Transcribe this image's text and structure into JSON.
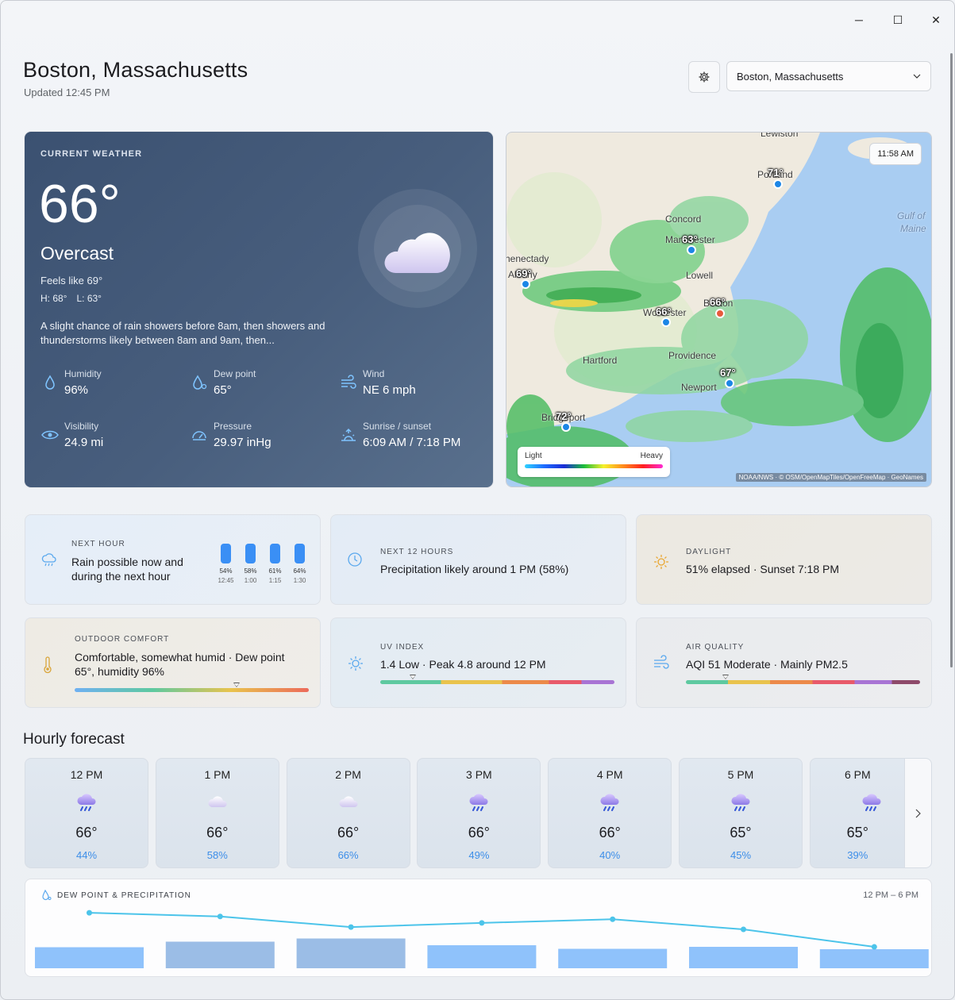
{
  "header": {
    "city": "Boston, Massachusetts",
    "updated": "Updated 12:45 PM",
    "location_select": "Boston, Massachusetts"
  },
  "window_controls": {
    "minimize": "─",
    "maximize": "☐",
    "close": "✕"
  },
  "current": {
    "label": "CURRENT WEATHER",
    "temp": "66°",
    "condition": "Overcast",
    "feels_like": "Feels like 69°",
    "high": "H: 68°",
    "low": "L: 63°",
    "description": "A slight chance of rain showers before 8am, then showers and thunderstorms likely between 8am and 9am, then...",
    "metrics": [
      {
        "label": "Humidity",
        "value": "96%",
        "icon": "humidity-icon"
      },
      {
        "label": "Dew point",
        "value": "65°",
        "icon": "dew-point-icon"
      },
      {
        "label": "Wind",
        "value": "NE 6 mph",
        "icon": "wind-icon"
      },
      {
        "label": "Visibility",
        "value": "24.9 mi",
        "icon": "visibility-icon"
      },
      {
        "label": "Pressure",
        "value": "29.97 inHg",
        "icon": "pressure-icon"
      },
      {
        "label": "Sunrise / sunset",
        "value": "6:09 AM / 7:18 PM",
        "icon": "sunrise-icon"
      }
    ]
  },
  "map": {
    "time": "11:58 AM",
    "legend_light": "Light",
    "legend_heavy": "Heavy",
    "attribution": "NOAA/NWS · © OSM/OpenMapTiles/OpenFreeMap · GeoNames",
    "places": [
      "Lewiston",
      "Portland",
      "Gulf of",
      "Maine",
      "Concord",
      "Manchester",
      "Schenectady",
      "Albany",
      "Lowell",
      "Boston",
      "Worcester",
      "Providence",
      "Hartford",
      "Newport",
      "Bridgeport"
    ],
    "temps": [
      "71°",
      "63°",
      "69°",
      "66°",
      "66°",
      "67°",
      "72°"
    ]
  },
  "tiles": {
    "next_hour": {
      "label": "NEXT HOUR",
      "text": "Rain possible now and during the next hour",
      "bars": [
        {
          "pct": "54%",
          "time": "12:45"
        },
        {
          "pct": "58%",
          "time": "1:00"
        },
        {
          "pct": "61%",
          "time": "1:15"
        },
        {
          "pct": "64%",
          "time": "1:30"
        }
      ]
    },
    "next_12": {
      "label": "NEXT 12 HOURS",
      "text": "Precipitation likely around 1 PM (58%)"
    },
    "daylight": {
      "label": "DAYLIGHT",
      "text": "51% elapsed · Sunset 7:18 PM"
    },
    "comfort": {
      "label": "OUTDOOR COMFORT",
      "text": "Comfortable, somewhat humid · Dew point 65°, humidity 96%",
      "level": 0.69
    },
    "uv": {
      "label": "UV INDEX",
      "text": "1.4 Low · Peak 4.8 around 12 PM",
      "level": 0.14
    },
    "air": {
      "label": "AIR QUALITY",
      "text": "AQI 51 Moderate · Mainly PM2.5",
      "level": 0.17
    }
  },
  "hourly": {
    "title": "Hourly forecast",
    "items": [
      {
        "time": "12 PM",
        "temp": "66°",
        "precip": "44%",
        "icon": "rain-cloud-icon"
      },
      {
        "time": "1 PM",
        "temp": "66°",
        "precip": "58%",
        "icon": "cloud-icon"
      },
      {
        "time": "2 PM",
        "temp": "66°",
        "precip": "66%",
        "icon": "cloud-icon"
      },
      {
        "time": "3 PM",
        "temp": "66°",
        "precip": "49%",
        "icon": "rain-cloud-icon"
      },
      {
        "time": "4 PM",
        "temp": "66°",
        "precip": "40%",
        "icon": "rain-cloud-icon"
      },
      {
        "time": "5 PM",
        "temp": "65°",
        "precip": "45%",
        "icon": "rain-cloud-icon"
      },
      {
        "time": "6 PM",
        "temp": "65°",
        "precip": "39%",
        "icon": "rain-cloud-icon"
      }
    ]
  },
  "dew_precip": {
    "label": "DEW POINT & PRECIPITATION",
    "range": "12 PM – 6 PM",
    "precip": [
      44,
      58,
      66,
      49,
      40,
      45,
      39
    ],
    "dew_relative": [
      0.86,
      0.78,
      0.55,
      0.64,
      0.72,
      0.5,
      0.12
    ]
  },
  "colors": {
    "accent": "#3a8ff5",
    "card_dark": "#485e7d",
    "line": "#4cc4ea",
    "bars": "#8fc2fb"
  }
}
